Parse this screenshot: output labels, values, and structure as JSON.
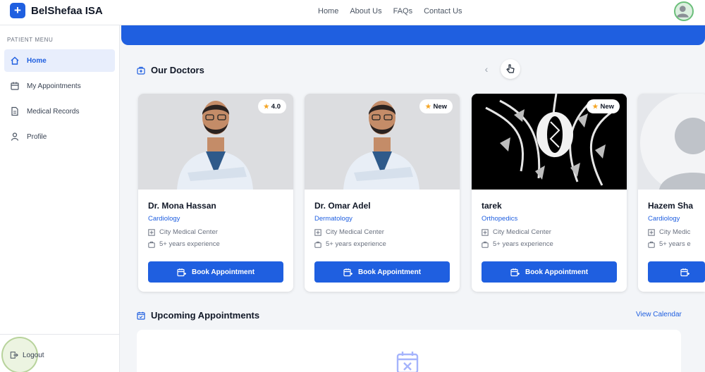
{
  "app": {
    "brand_name": "BelShefaa ISA",
    "brand_icon": "plus-icon",
    "accent_color": "#1f5fe0"
  },
  "topnav": {
    "links": [
      "Home",
      "About Us",
      "FAQs",
      "Contact Us"
    ]
  },
  "sidebar": {
    "caption": "PATIENT MENU",
    "items": [
      {
        "label": "Home",
        "icon": "home-icon",
        "active": true
      },
      {
        "label": "My Appointments",
        "icon": "calendar-icon",
        "active": false
      },
      {
        "label": "Medical Records",
        "icon": "document-icon",
        "active": false
      },
      {
        "label": "Profile",
        "icon": "user-icon",
        "active": false
      }
    ],
    "logout_label": "Logout"
  },
  "doctors_section": {
    "title": "Our Doctors",
    "prev_label": "‹",
    "book_label": "Book Appointment",
    "doctors": [
      {
        "name": "Dr. Mona Hassan",
        "specialty": "Cardiology",
        "location": "City Medical Center",
        "experience": "5+ years experience",
        "badge": "4.0"
      },
      {
        "name": "Dr. Omar Adel",
        "specialty": "Dermatology",
        "location": "City Medical Center",
        "experience": "5+ years experience",
        "badge": "New"
      },
      {
        "name": "tarek",
        "specialty": "Orthopedics",
        "location": "City Medical Center",
        "experience": "5+ years experience",
        "badge": "New"
      },
      {
        "name": "Hazem Sha",
        "specialty": "Cardiology",
        "location": "City Medic",
        "experience": "5+ years e",
        "badge": ""
      }
    ]
  },
  "appointments_section": {
    "title": "Upcoming Appointments",
    "view_calendar": "View Calendar"
  }
}
